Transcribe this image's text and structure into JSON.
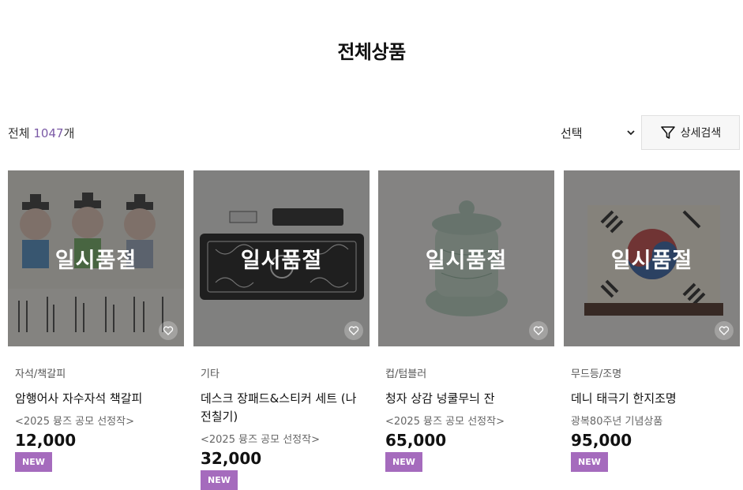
{
  "page": {
    "title": "전체상품"
  },
  "toolbar": {
    "total_prefix": "전체 ",
    "total_count": "1047",
    "total_suffix": "개",
    "sort_selected": "선택",
    "filter_label": "상세검색"
  },
  "products": [
    {
      "status": "일시품절",
      "category": "자석/책갈피",
      "name": "암행어사 자수자석 책갈피",
      "subtitle": "<2025 뮹즈 공모 선정작>",
      "price": "12,000",
      "badge": "NEW"
    },
    {
      "status": "일시품절",
      "category": "기타",
      "name": "데스크 장패드&스티커 세트 (나전칠기)",
      "subtitle": "<2025 뮹즈 공모 선정작>",
      "price": "32,000",
      "badge": "NEW"
    },
    {
      "status": "일시품절",
      "category": "컵/텀블러",
      "name": "청자 상감 넝쿨무늬 잔",
      "subtitle": "<2025 뮹즈 공모 선정작>",
      "price": "65,000",
      "badge": "NEW"
    },
    {
      "status": "일시품절",
      "category": "무드등/조명",
      "name": "데니 태극기 한지조명",
      "subtitle": "광복80주년 기념상품",
      "price": "95,000",
      "badge": "NEW"
    }
  ],
  "colors": {
    "accent": "#7b5aa6",
    "badge": "#a56bbd"
  },
  "icons": [
    "chevron-down-icon",
    "filter-icon",
    "heart-icon"
  ]
}
